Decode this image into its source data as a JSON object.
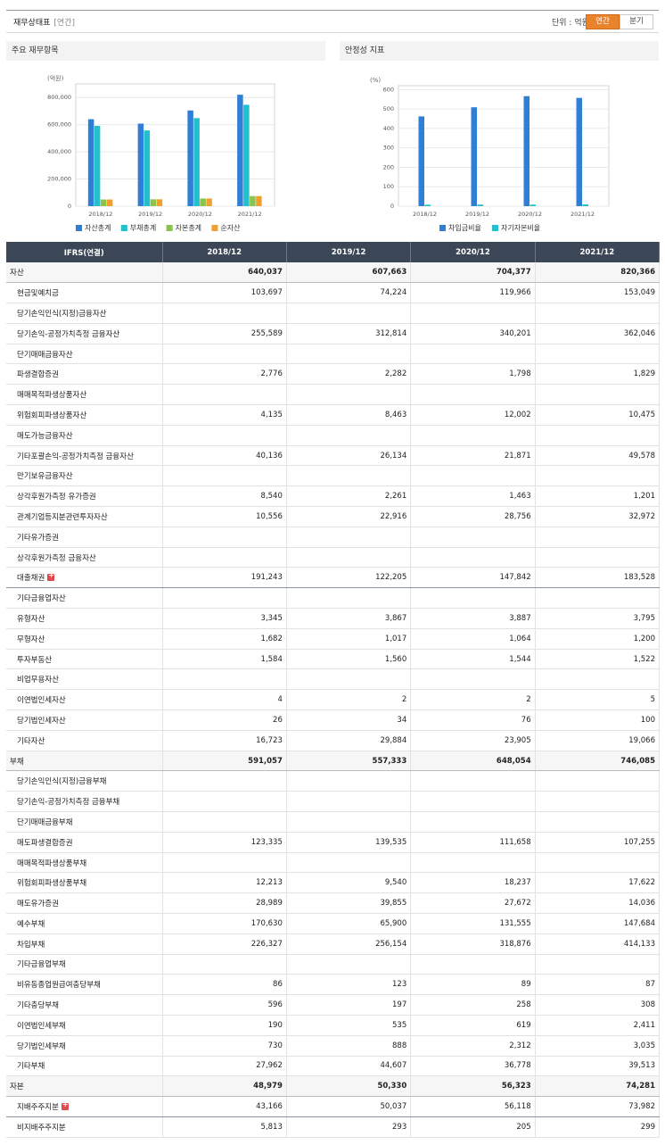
{
  "header": {
    "title": "재무상태표",
    "period_tag": "[연간]",
    "unit_label": "단위 : 억원",
    "toggle": [
      "연간",
      "분기"
    ]
  },
  "panels": {
    "left_title": "주요 재무항목",
    "right_title": "안정성 지표"
  },
  "colors": {
    "asset": "#2f7fd6",
    "liab": "#22c0cc",
    "equity": "#8cc34a",
    "net": "#f0a030",
    "accent": "#e9832c"
  },
  "chart_data": [
    {
      "type": "bar",
      "unit_label": "(억원)",
      "categories": [
        "2018/12",
        "2019/12",
        "2020/12",
        "2021/12"
      ],
      "series": [
        {
          "name": "자산총계",
          "values": [
            640037,
            607663,
            704377,
            820366
          ]
        },
        {
          "name": "부채총계",
          "values": [
            591057,
            557333,
            648054,
            746085
          ]
        },
        {
          "name": "자본총계",
          "values": [
            48979,
            50330,
            56323,
            74281
          ]
        },
        {
          "name": "순자산",
          "values": [
            48979,
            50330,
            56323,
            74281
          ]
        }
      ],
      "ylim": [
        0,
        900000
      ],
      "yticks": [
        "0",
        "200,000",
        "400,000",
        "600,000",
        "800,000"
      ],
      "ytick_values": [
        0,
        200000,
        400000,
        600000,
        800000
      ],
      "grid": true,
      "legend": "bottom"
    },
    {
      "type": "bar",
      "unit_label": "(%)",
      "categories": [
        "2018/12",
        "2019/12",
        "2020/12",
        "2021/12"
      ],
      "series": [
        {
          "name": "차입금비율",
          "values": [
            462,
            509,
            566,
            557
          ]
        },
        {
          "name": "자기자본비율",
          "values": [
            7.6,
            8.3,
            8.0,
            9.1
          ]
        }
      ],
      "ylim": [
        0,
        620
      ],
      "yticks": [
        "0",
        "100",
        "200",
        "300",
        "400",
        "500",
        "600"
      ],
      "ytick_values": [
        0,
        100,
        200,
        300,
        400,
        500,
        600
      ],
      "grid": true,
      "legend": "bottom"
    }
  ],
  "table": {
    "headers": [
      "IFRS(연결)",
      "2018/12",
      "2019/12",
      "2020/12",
      "2021/12"
    ],
    "rows": [
      {
        "label": "자산",
        "values": [
          "640,037",
          "607,663",
          "704,377",
          "820,366"
        ],
        "major": true
      },
      {
        "label": "현금및예치금",
        "values": [
          "103,697",
          "74,224",
          "119,966",
          "153,049"
        ]
      },
      {
        "label": "당기손익인식(지정)금융자산",
        "values": [
          "",
          "",
          "",
          ""
        ]
      },
      {
        "label": "당기손익-공정가치측정 금융자산",
        "values": [
          "255,589",
          "312,814",
          "340,201",
          "362,046"
        ]
      },
      {
        "label": "단기매매금융자산",
        "values": [
          "",
          "",
          "",
          ""
        ]
      },
      {
        "label": "파생결합증권",
        "values": [
          "2,776",
          "2,282",
          "1,798",
          "1,829"
        ]
      },
      {
        "label": "매매목적파생상품자산",
        "values": [
          "",
          "",
          "",
          ""
        ]
      },
      {
        "label": "위험회피파생상품자산",
        "values": [
          "4,135",
          "8,463",
          "12,002",
          "10,475"
        ]
      },
      {
        "label": "매도가능금융자산",
        "values": [
          "",
          "",
          "",
          ""
        ]
      },
      {
        "label": "기타포괄손익-공정가치측정 금융자산",
        "values": [
          "40,136",
          "26,134",
          "21,871",
          "49,578"
        ]
      },
      {
        "label": "만기보유금융자산",
        "values": [
          "",
          "",
          "",
          ""
        ]
      },
      {
        "label": "상각후원가측정 유가증권",
        "values": [
          "8,540",
          "2,261",
          "1,463",
          "1,201"
        ]
      },
      {
        "label": "관계기업등지분관련투자자산",
        "values": [
          "10,556",
          "22,916",
          "28,756",
          "32,972"
        ]
      },
      {
        "label": "기타유가증권",
        "values": [
          "",
          "",
          "",
          ""
        ]
      },
      {
        "label": "상각후원가측정 금융자산",
        "values": [
          "",
          "",
          "",
          ""
        ]
      },
      {
        "label": "대출채권",
        "values": [
          "191,243",
          "122,205",
          "147,842",
          "183,528"
        ],
        "plus": true,
        "sep": true
      },
      {
        "label": "기타금융업자산",
        "values": [
          "",
          "",
          "",
          ""
        ]
      },
      {
        "label": "유형자산",
        "values": [
          "3,345",
          "3,867",
          "3,887",
          "3,795"
        ]
      },
      {
        "label": "무형자산",
        "values": [
          "1,682",
          "1,017",
          "1,064",
          "1,200"
        ]
      },
      {
        "label": "투자부동산",
        "values": [
          "1,584",
          "1,560",
          "1,544",
          "1,522"
        ]
      },
      {
        "label": "비업무용자산",
        "values": [
          "",
          "",
          "",
          ""
        ]
      },
      {
        "label": "이연법인세자산",
        "values": [
          "4",
          "2",
          "2",
          "5"
        ]
      },
      {
        "label": "당기법인세자산",
        "values": [
          "26",
          "34",
          "76",
          "100"
        ]
      },
      {
        "label": "기타자산",
        "values": [
          "16,723",
          "29,884",
          "23,905",
          "19,066"
        ]
      },
      {
        "label": "부채",
        "values": [
          "591,057",
          "557,333",
          "648,054",
          "746,085"
        ],
        "major": true
      },
      {
        "label": "당기손익인식(지정)금융부채",
        "values": [
          "",
          "",
          "",
          ""
        ]
      },
      {
        "label": "당기손익-공정가치측정 금융부채",
        "values": [
          "",
          "",
          "",
          ""
        ]
      },
      {
        "label": "단기매매금융부채",
        "values": [
          "",
          "",
          "",
          ""
        ]
      },
      {
        "label": "매도파생결합증권",
        "values": [
          "123,335",
          "139,535",
          "111,658",
          "107,255"
        ]
      },
      {
        "label": "매매목적파생상품부채",
        "values": [
          "",
          "",
          "",
          ""
        ]
      },
      {
        "label": "위험회피파생상품부채",
        "values": [
          "12,213",
          "9,540",
          "18,237",
          "17,622"
        ]
      },
      {
        "label": "매도유가증권",
        "values": [
          "28,989",
          "39,855",
          "27,672",
          "14,036"
        ]
      },
      {
        "label": "예수부채",
        "values": [
          "170,630",
          "65,900",
          "131,555",
          "147,684"
        ]
      },
      {
        "label": "차입부채",
        "values": [
          "226,327",
          "256,154",
          "318,876",
          "414,133"
        ]
      },
      {
        "label": "기타금융업부채",
        "values": [
          "",
          "",
          "",
          ""
        ]
      },
      {
        "label": "비유동종업원급여충당부채",
        "values": [
          "86",
          "123",
          "89",
          "87"
        ]
      },
      {
        "label": "기타충당부채",
        "values": [
          "596",
          "197",
          "258",
          "308"
        ]
      },
      {
        "label": "이연법인세부채",
        "values": [
          "190",
          "535",
          "619",
          "2,411"
        ]
      },
      {
        "label": "당기법인세부채",
        "values": [
          "730",
          "888",
          "2,312",
          "3,035"
        ]
      },
      {
        "label": "기타부채",
        "values": [
          "27,962",
          "44,607",
          "36,778",
          "39,513"
        ]
      },
      {
        "label": "자본",
        "values": [
          "48,979",
          "50,330",
          "56,323",
          "74,281"
        ],
        "major": true
      },
      {
        "label": "지배주주지분",
        "values": [
          "43,166",
          "50,037",
          "56,118",
          "73,982"
        ],
        "plus": true,
        "sep": true
      },
      {
        "label": "비지배주주지분",
        "values": [
          "5,813",
          "293",
          "205",
          "299"
        ]
      }
    ]
  }
}
